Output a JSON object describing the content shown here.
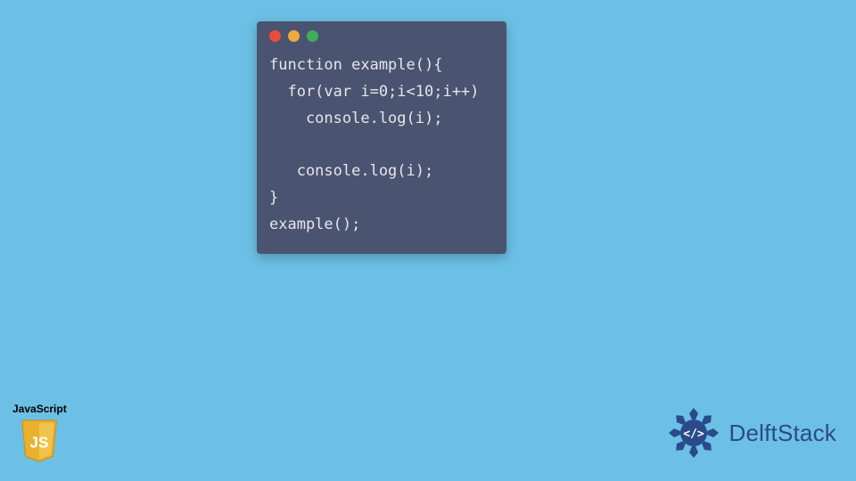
{
  "code_window": {
    "traffic_colors": {
      "red": "#e94b3c",
      "yellow": "#f0a93c",
      "green": "#3fae5a"
    },
    "lines": [
      "function example(){",
      "  for(var i=0;i<10;i++)",
      "    console.log(i);",
      "",
      "   console.log(i);",
      "}",
      "example();"
    ]
  },
  "js_badge": {
    "label": "JavaScript",
    "shield_text": "JS"
  },
  "brand": {
    "name": "DelftStack",
    "logo_glyph": "</>"
  }
}
